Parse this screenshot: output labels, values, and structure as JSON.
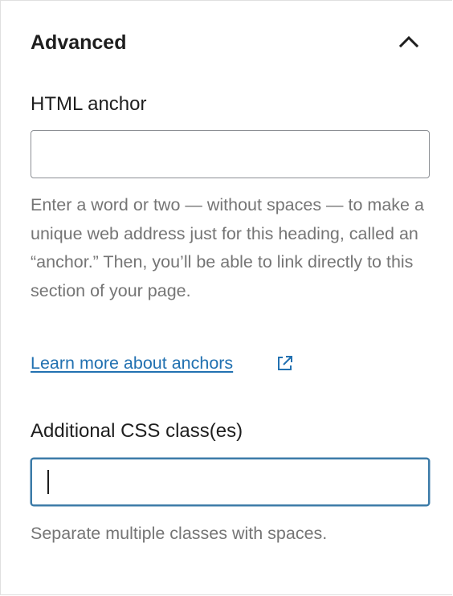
{
  "panel": {
    "title": "Advanced",
    "expanded": true,
    "toggle_icon": "chevron-up-icon"
  },
  "html_anchor": {
    "label": "HTML anchor",
    "value": "",
    "placeholder": "",
    "help": "Enter a word or two — without spaces — to make a unique web address just for this heading, called an “anchor.” Then, you’ll be able to link directly to this section of your page.",
    "link_label": "Learn more about anchors",
    "link_icon": "external-link-icon"
  },
  "css_classes": {
    "label": "Additional CSS class(es)",
    "value": "",
    "placeholder": "",
    "help": "Separate multiple classes with spaces.",
    "focused": true
  },
  "colors": {
    "link": "#2271b1",
    "focus_border": "#3c7ba8",
    "help_text": "#757575",
    "text": "#1e1e1e"
  }
}
